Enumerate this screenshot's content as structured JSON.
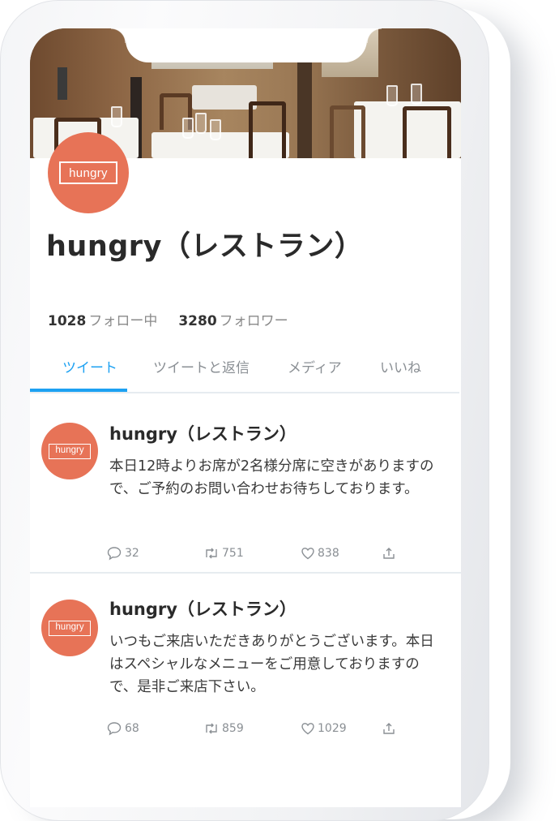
{
  "profile": {
    "avatar_text": "hungry",
    "name": "hungry（レストラン）",
    "following_count": "1028",
    "following_label": "フォロー中",
    "followers_count": "3280",
    "followers_label": "フォロワー"
  },
  "tabs": [
    {
      "label": "ツイート",
      "active": true
    },
    {
      "label": "ツイートと返信",
      "active": false
    },
    {
      "label": "メディア",
      "active": false
    },
    {
      "label": "いいね",
      "active": false
    }
  ],
  "tweets": [
    {
      "avatar_text": "hungry",
      "name": "hungry（レストラン）",
      "body": "本日12時よりお席が2名様分席に空きがありますので、ご予約のお問い合わせお待ちしております。",
      "replies": "32",
      "retweets": "751",
      "likes": "838"
    },
    {
      "avatar_text": "hungry",
      "name": "hungry（レストラン）",
      "body": "いつもご来店いただきありがとうございます。本日はスペシャルなメニューをご用意しておりますので、是非ご来店下さい。",
      "replies": "68",
      "retweets": "859",
      "likes": "1029"
    }
  ],
  "colors": {
    "brand": "#e77357",
    "accent": "#1da1f2",
    "text": "#2a2a2a",
    "muted": "#8a8f94"
  },
  "icons": [
    "reply-icon",
    "retweet-icon",
    "like-icon",
    "share-icon"
  ]
}
